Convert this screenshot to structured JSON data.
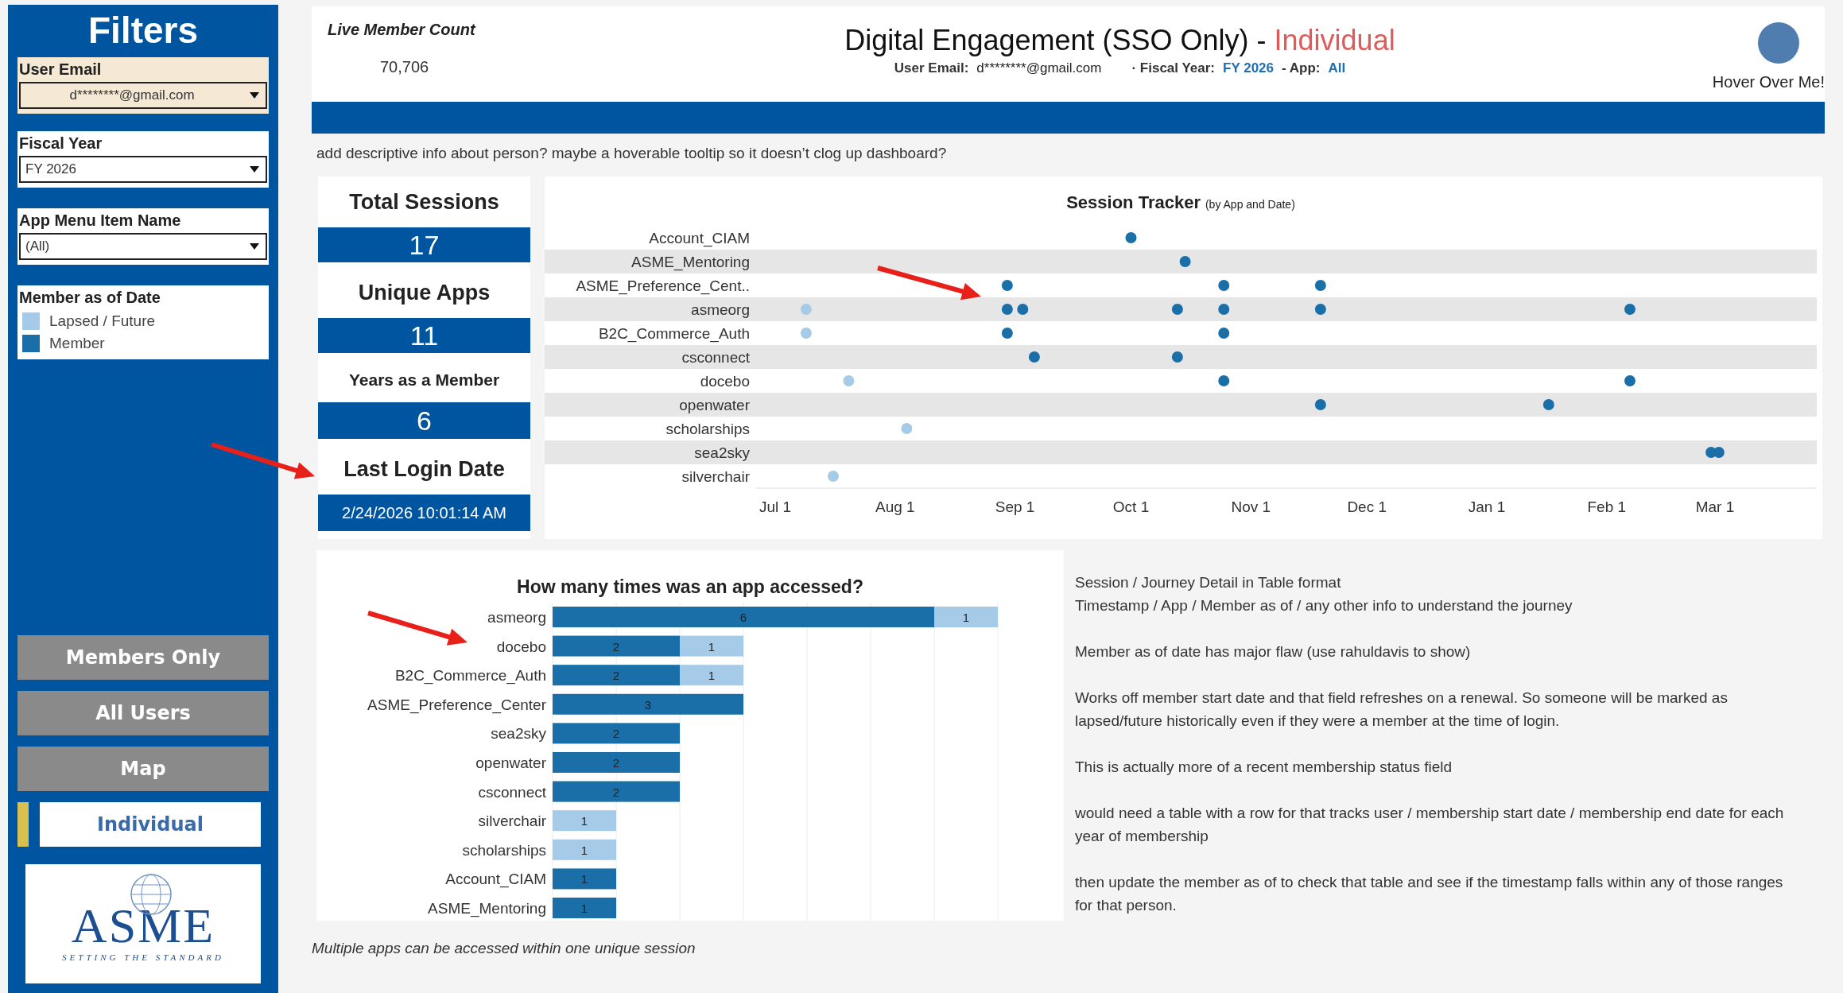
{
  "sidebar": {
    "title": "Filters",
    "filters": [
      {
        "kind": "dropdown",
        "label": "User Email",
        "value": "d********@gmail.com",
        "highlighted": true
      },
      {
        "kind": "dropdown",
        "label": "Fiscal Year",
        "value": "FY 2026",
        "highlighted": false
      },
      {
        "kind": "dropdown",
        "label": "App Menu Item Name",
        "value": "(All)",
        "highlighted": false
      },
      {
        "kind": "legend",
        "label": "Member as of Date",
        "items": [
          {
            "label": "Lapsed / Future",
            "color": "#a6cbe8"
          },
          {
            "label": "Member",
            "color": "#1a6fa9"
          }
        ]
      }
    ],
    "nav": [
      {
        "label": "Members Only",
        "selected": false
      },
      {
        "label": "All Users",
        "selected": false
      },
      {
        "label": "Map",
        "selected": false
      },
      {
        "label": "Individual",
        "selected": true
      }
    ],
    "logo": {
      "name": "ASME",
      "tagline": "SETTING THE STANDARD"
    }
  },
  "header": {
    "live_count_label": "Live Member Count",
    "live_count": "70,706",
    "title": "Digital Engagement (SSO Only) -",
    "title_highlight": "Individual",
    "summary": [
      {
        "label": "User Email:",
        "value": "d********@gmail.com",
        "kind": "plain"
      },
      {
        "label": "· Fiscal Year:",
        "value": "FY 2026",
        "kind": "accent"
      },
      {
        "label": "- App:",
        "value": "All",
        "kind": "accent"
      }
    ],
    "hover_label": "Hover Over Me!"
  },
  "note": "add descriptive info about person? maybe a hoverable tooltip so it doesn’t clog up dashboard?",
  "kpis": [
    {
      "label": "Total Sessions",
      "value": "17",
      "kind": "large"
    },
    {
      "label": "Unique Apps",
      "value": "11",
      "kind": "large"
    },
    {
      "label": "Years as a Member",
      "value": "6",
      "kind": "medium"
    },
    {
      "label": "Last Login Date",
      "value": "2/24/2026 10:01:14 AM",
      "kind": "small"
    }
  ],
  "session_tracker": {
    "title": "Session Tracker",
    "subtitle": "(by App and Date)",
    "app_labels": [
      "Account_CIAM",
      "ASME_Mentoring",
      "ASME_Preference_Cent..",
      "asmeorg",
      "B2C_Commerce_Auth",
      "csconnect",
      "docebo",
      "openwater",
      "scholarships",
      "sea2sky",
      "silverchair"
    ],
    "date_labels": [
      "Jul 1",
      "Aug 1",
      "Sep 1",
      "Oct 1",
      "Nov 1",
      "Dec 1",
      "Jan 1",
      "Feb 1",
      "Mar 1"
    ]
  },
  "app_access": {
    "chart_data": {
      "type": "bar",
      "orientation": "horizontal",
      "stacked": true,
      "data_labels": true,
      "title": "How many times was an app accessed?",
      "categories": [
        "asmeorg",
        "docebo",
        "B2C_Commerce_Auth",
        "ASME_Preference_Center",
        "sea2sky",
        "openwater",
        "csconnect",
        "silverchair",
        "scholarships",
        "Account_CIAM",
        "ASME_Mentoring"
      ],
      "xlim": [
        0,
        7
      ],
      "series": [
        {
          "color": "#1a6fa9",
          "values": [
            6,
            2,
            2,
            3,
            2,
            2,
            2,
            null,
            null,
            1,
            1
          ]
        },
        {
          "color": "#a6cbe8",
          "values": [
            1,
            1,
            1,
            null,
            null,
            null,
            null,
            1,
            1,
            null,
            null
          ]
        }
      ]
    },
    "caption": "Multiple apps can be accessed within one unique session"
  },
  "notes": [
    "Session / Journey Detail in Table format",
    "Timestamp / App / Member as of  / any other info to understand the journey",
    "Member as of date has major flaw (use rahuldavis to show)",
    "Works off member start date and that field refreshes on a renewal. So someone will be marked as lapsed/future historically even if they were a member at the time of login.",
    "This is actually more of a recent membership status field",
    "would need a table with a row for that tracks user / membership start date / membership end date for each year of membership",
    "then update the member as of to check that table and see if the timestamp falls within any of those ranges for that person."
  ]
}
